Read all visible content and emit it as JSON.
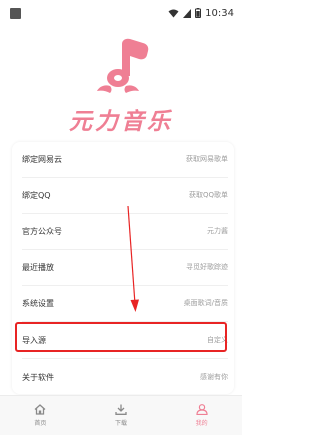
{
  "status_bar": {
    "time": "10:34"
  },
  "brand": {
    "title": "元力音乐",
    "color": "#ef7f94"
  },
  "menu": [
    {
      "label": "绑定网易云",
      "value": "获取网易歌单"
    },
    {
      "label": "绑定QQ",
      "value": "获取QQ歌单"
    },
    {
      "label": "官方公众号",
      "value": "元力酱"
    },
    {
      "label": "最近播放",
      "value": "寻觅好歌踪迹"
    },
    {
      "label": "系统设置",
      "value": "桌面歌词/音质"
    },
    {
      "label": "导入源",
      "value": "自定义"
    },
    {
      "label": "关于软件",
      "value": "感谢有你"
    }
  ],
  "bottom_nav": [
    {
      "label": "首页",
      "icon": "home-icon"
    },
    {
      "label": "下载",
      "icon": "download-icon"
    },
    {
      "label": "我的",
      "icon": "profile-icon",
      "active": true
    }
  ],
  "annotation": {
    "color": "#e82424"
  }
}
